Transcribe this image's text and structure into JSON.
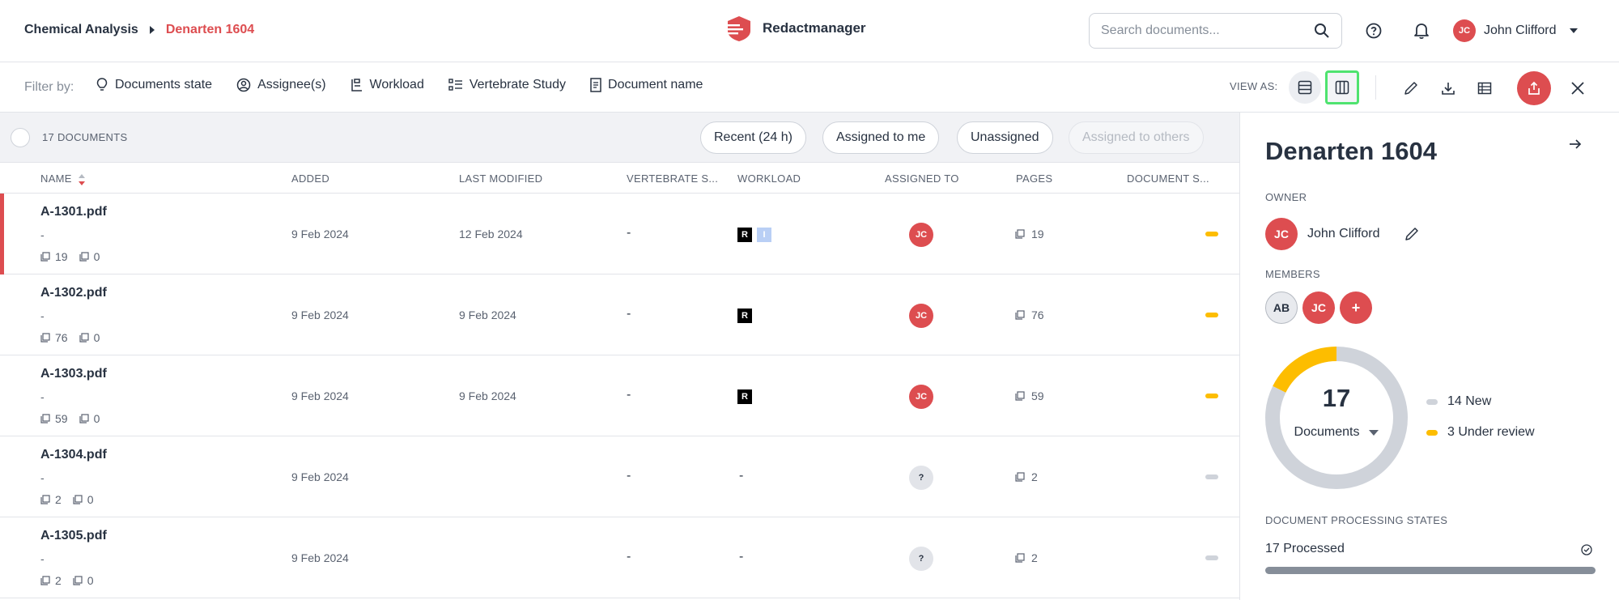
{
  "header": {
    "breadcrumb_root": "Chemical Analysis",
    "breadcrumb_current": "Denarten 1604",
    "brand": "Redactmanager",
    "search_placeholder": "Search documents...",
    "user_initials": "JC",
    "user_name": "John Clifford"
  },
  "filterbar": {
    "label": "Filter by:",
    "filters": [
      "Documents state",
      "Assignee(s)",
      "Workload",
      "Vertebrate Study",
      "Document name"
    ],
    "view_as": "VIEW AS:"
  },
  "list": {
    "count": "17 DOCUMENTS",
    "quick_filters": [
      "Recent (24 h)",
      "Assigned to me",
      "Unassigned",
      "Assigned to others"
    ],
    "columns": [
      "NAME",
      "ADDED",
      "LAST MODIFIED",
      "VERTEBRATE S...",
      "WORKLOAD",
      "ASSIGNED TO",
      "PAGES",
      "DOCUMENT S..."
    ],
    "rows": [
      {
        "name": "A-1301.pdf",
        "sub": "-",
        "meta_pages": "19",
        "meta_other": "0",
        "added": "9 Feb 2024",
        "modified": "12 Feb 2024",
        "vertebrate": "-",
        "workload": [
          "R",
          "I"
        ],
        "assignee": "JC",
        "pages": "19",
        "state_color": "#fdbd00",
        "selected": true
      },
      {
        "name": "A-1302.pdf",
        "sub": "-",
        "meta_pages": "76",
        "meta_other": "0",
        "added": "9 Feb 2024",
        "modified": "9 Feb 2024",
        "vertebrate": "-",
        "workload": [
          "R"
        ],
        "assignee": "JC",
        "pages": "76",
        "state_color": "#fdbd00",
        "selected": false
      },
      {
        "name": "A-1303.pdf",
        "sub": "-",
        "meta_pages": "59",
        "meta_other": "0",
        "added": "9 Feb 2024",
        "modified": "9 Feb 2024",
        "vertebrate": "-",
        "workload": [
          "R"
        ],
        "assignee": "JC",
        "pages": "59",
        "state_color": "#fdbd00",
        "selected": false
      },
      {
        "name": "A-1304.pdf",
        "sub": "-",
        "meta_pages": "2",
        "meta_other": "0",
        "added": "9 Feb 2024",
        "modified": "",
        "vertebrate": "-",
        "workload_dash": "-",
        "assignee": "?",
        "pages": "2",
        "state_color": "#cfd3da",
        "selected": false
      },
      {
        "name": "A-1305.pdf",
        "sub": "-",
        "meta_pages": "2",
        "meta_other": "0",
        "added": "9 Feb 2024",
        "modified": "",
        "vertebrate": "-",
        "workload_dash": "-",
        "assignee": "?",
        "pages": "2",
        "state_color": "#cfd3da",
        "selected": false
      }
    ]
  },
  "panel": {
    "title": "Denarten 1604",
    "owner_label": "OWNER",
    "owner_initials": "JC",
    "owner_name": "John Clifford",
    "members_label": "MEMBERS",
    "members": [
      "AB",
      "JC"
    ],
    "add_member": "+",
    "total": "17",
    "total_label": "Documents",
    "legend": [
      {
        "label": "14 New",
        "value": 14,
        "color": "#cfd3da"
      },
      {
        "label": "3 Under review",
        "value": 3,
        "color": "#fdbd00"
      }
    ],
    "processing_label": "DOCUMENT PROCESSING STATES",
    "processed": "17 Processed",
    "processed_fraction": 1.0
  },
  "colors": {
    "accent": "#dd4d50",
    "review": "#fdbd00",
    "new": "#cfd3da",
    "view_active_border": "#4fe36f"
  }
}
